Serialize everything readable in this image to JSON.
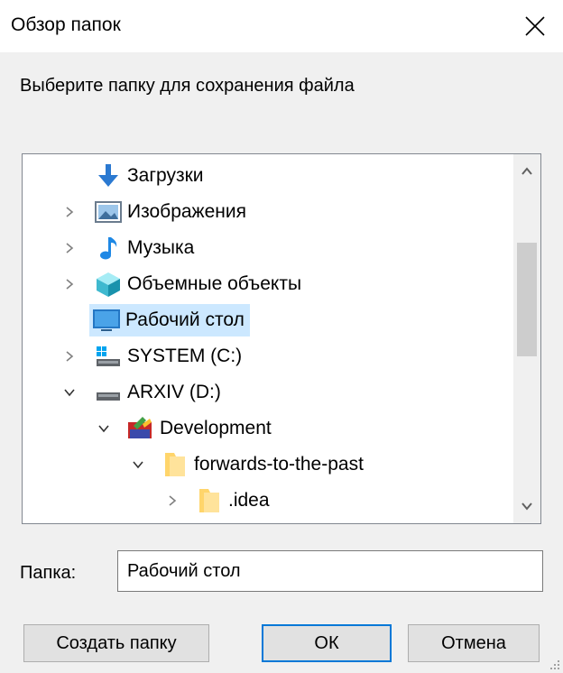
{
  "window": {
    "title": "Обзор папок"
  },
  "instruction": "Выберите папку для сохранения файла",
  "tree": [
    {
      "label": "Загрузки",
      "icon": "downloads-icon",
      "expander": "none",
      "selected": false
    },
    {
      "label": "Изображения",
      "icon": "pictures-icon",
      "expander": "collapsed",
      "selected": false
    },
    {
      "label": "Музыка",
      "icon": "music-icon",
      "expander": "collapsed",
      "selected": false
    },
    {
      "label": "Объемные объекты",
      "icon": "3d-objects-icon",
      "expander": "collapsed",
      "selected": false
    },
    {
      "label": "Рабочий стол",
      "icon": "desktop-icon",
      "expander": "none",
      "selected": true
    },
    {
      "label": "SYSTEM (C:)",
      "icon": "system-drive-icon",
      "expander": "collapsed",
      "selected": false
    },
    {
      "label": "ARXIV (D:)",
      "icon": "drive-icon",
      "expander": "expanded",
      "selected": false
    },
    {
      "label": "Development",
      "icon": "library-folder-icon",
      "expander": "expanded",
      "selected": false
    },
    {
      "label": "forwards-to-the-past",
      "icon": "folder-icon",
      "expander": "expanded",
      "selected": false
    },
    {
      "label": ".idea",
      "icon": "folder-icon",
      "expander": "collapsed",
      "selected": false
    }
  ],
  "folder": {
    "label": "Папка:",
    "value": "Рабочий стол"
  },
  "buttons": {
    "new_folder": "Создать папку",
    "ok": "ОК",
    "cancel": "Отмена"
  },
  "colors": {
    "selection": "#cce8ff",
    "accent": "#0078d7",
    "dialog_bg": "#f0f0f0"
  }
}
